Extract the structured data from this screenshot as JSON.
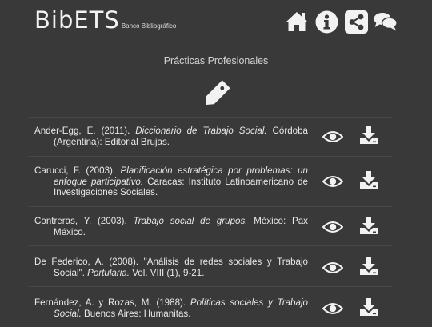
{
  "brand": {
    "logo_text": "BibETS",
    "subtitle": "Banco Bibliográfico"
  },
  "nav": {
    "icons": [
      "home-icon",
      "info-icon",
      "share-icon",
      "chat-icon"
    ]
  },
  "section": {
    "title": "Prácticas Profesionales",
    "icon": "tag-icon"
  },
  "colors": {
    "background": "#393939",
    "icon": "#f2f2f2",
    "text": "#e8e8e8"
  },
  "references": [
    {
      "author": "Ander-Egg, E. (2011). ",
      "title": "Diccionario de Trabajo Social.",
      "rest": " Córdoba (Argentina): Editorial Brujas."
    },
    {
      "author": "Carucci, F. (2003). ",
      "title": "Planificación estratégica por problemas: un enfoque participativo.",
      "rest": " Caracas: Instituto Latinoamericano de Investigaciones Sociales."
    },
    {
      "author": "Contreras, Y. (2003). ",
      "title": "Trabajo social de grupos.",
      "rest": " México: Pax México."
    },
    {
      "author": "De Federico, A. (2008). \"Análisis de redes sociales y Trabajo Social\". ",
      "title": "Portularia.",
      "rest": " Vol. VIII (1), 9-21."
    },
    {
      "author": "Fernández, A. y Rozas, M. (1988). ",
      "title": "Políticas sociales y Trabajo Social.",
      "rest": " Buenos Aires: Humanitas."
    }
  ]
}
